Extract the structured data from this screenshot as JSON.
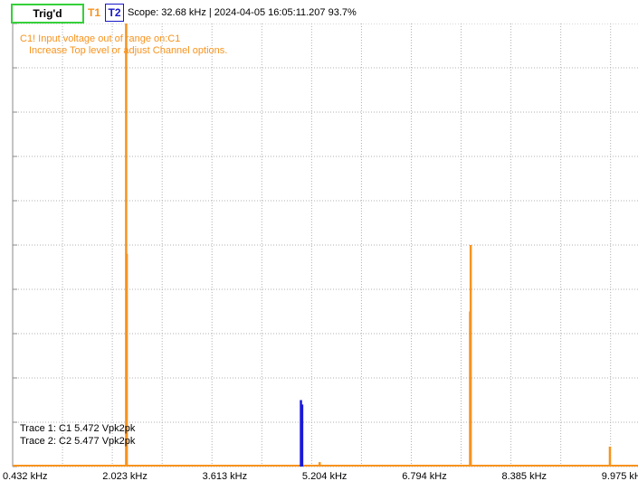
{
  "status": {
    "trig_label": "Trig'd",
    "t1_label": "T1",
    "t2_label": "T2",
    "scope_info": "Scope: 32.68 kHz | 2024-04-05 16:05:11.207 93.7%"
  },
  "warning": {
    "line1": "C1! Input voltage out of range on:C1",
    "line2": "Increase Top level or adjust Channel options."
  },
  "traces": [
    {
      "label": "Trace 1: C1 5.472 Vpk2pk"
    },
    {
      "label": "Trace 2: C2 5.477 Vpk2pk"
    }
  ],
  "colors": {
    "trace1": "#f7931e",
    "trace2": "#1a1ad8",
    "grid": "#b0b0b0",
    "trig_border": "#35d03a"
  },
  "chart_data": {
    "type": "line",
    "x_unit": "kHz",
    "x_tick_labels": [
      "0.432 kHz",
      "2.023 kHz",
      "3.613 kHz",
      "5.204 kHz",
      "6.794 kHz",
      "8.385 kHz",
      "9.975 kHz"
    ],
    "xlim": [
      0.432,
      10.45
    ],
    "ylim": [
      0,
      100
    ],
    "grid": true,
    "series": [
      {
        "name": "Trace 1",
        "color": "#f7931e",
        "points": [
          [
            0.9,
            0.4
          ],
          [
            1.5,
            0.3
          ],
          [
            2.25,
            100
          ],
          [
            2.26,
            48
          ],
          [
            3.2,
            0.4
          ],
          [
            4.4,
            0.3
          ],
          [
            5.35,
            1.0
          ],
          [
            6.1,
            0.4
          ],
          [
            7.1,
            0.4
          ],
          [
            7.77,
            50
          ],
          [
            7.76,
            35
          ],
          [
            8.9,
            0.4
          ],
          [
            10.0,
            4.5
          ]
        ]
      },
      {
        "name": "Trace 2",
        "color": "#1a1ad8",
        "points": [
          [
            5.05,
            15
          ],
          [
            5.07,
            14
          ]
        ]
      }
    ]
  }
}
